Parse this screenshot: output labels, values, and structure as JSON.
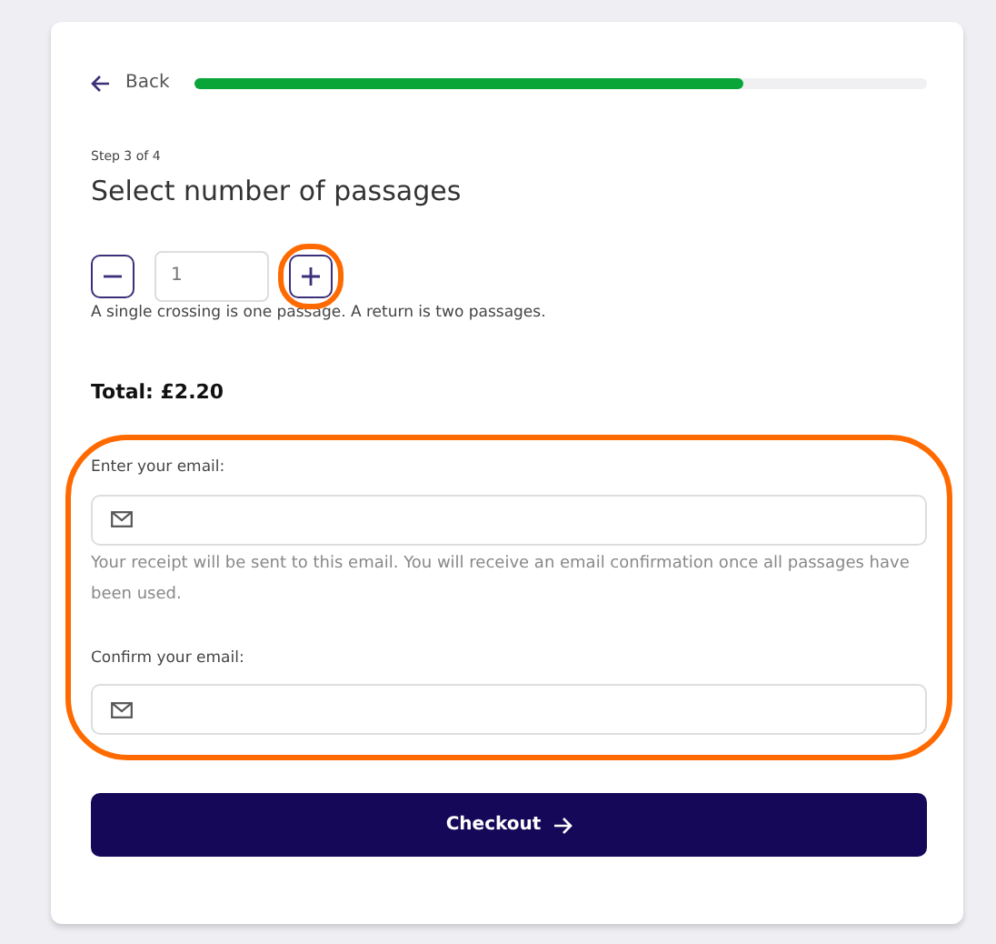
{
  "back": {
    "label": "Back"
  },
  "progress": {
    "level": 0.75
  },
  "step": "Step 3 of 4",
  "heading": "Select number of passages",
  "quantity": {
    "value": "1",
    "increase_highlighted": true
  },
  "quantity_help": "A single crossing is one passage. A return is two passages.",
  "total": "Total: £2.20",
  "email_section": {
    "highlighted": true,
    "fields": [
      {
        "label": "Enter your email:",
        "help": "Your receipt will be sent to this email. You will receive an email confirmation once all passages have been used."
      },
      {
        "label": "Confirm your email:"
      }
    ]
  },
  "checkout": {
    "label": "Checkout"
  }
}
